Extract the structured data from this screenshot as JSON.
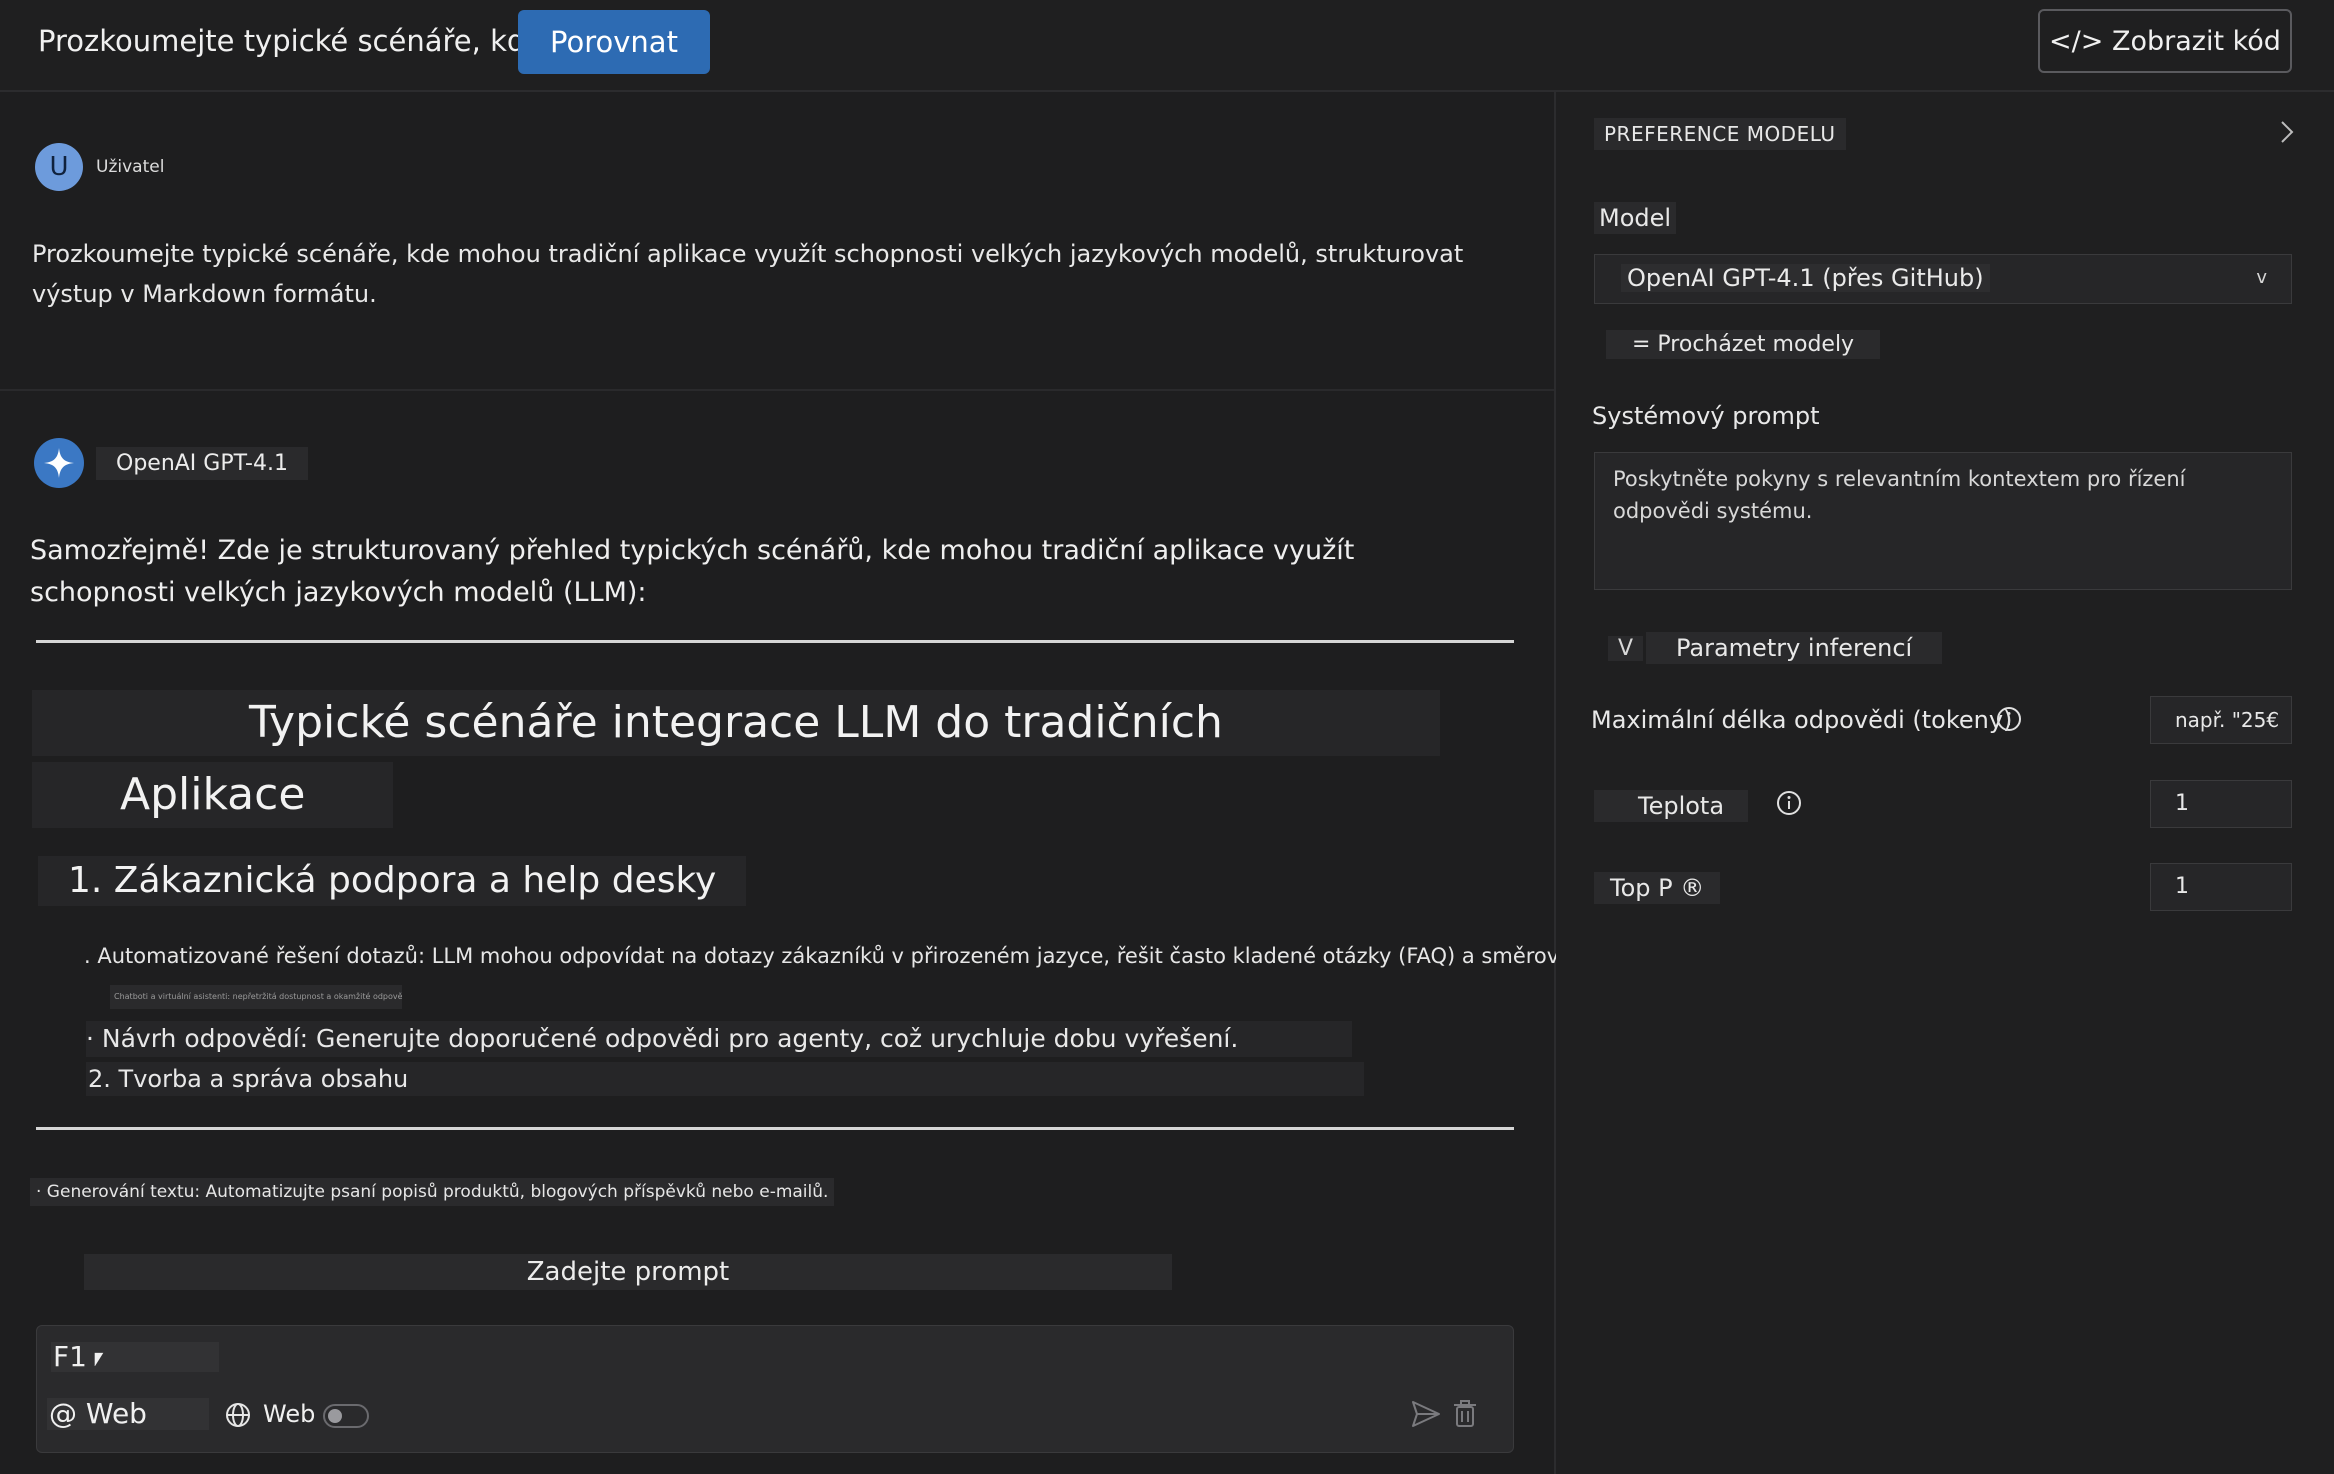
{
  "topbar": {
    "title": "Prozkoumejte typické scénáře, kde ...",
    "compare_label": "Porovnat",
    "show_code_label": "</> Zobrazit kód"
  },
  "chat": {
    "user": {
      "avatar_letter": "U",
      "name": "Uživatel",
      "message": "Prozkoumejte typické scénáře, kde mohou tradiční aplikace využít schopnosti velkých jazykových modelů, strukturovat výstup v Markdown formátu."
    },
    "assistant": {
      "name": "OpenAI GPT-4.1",
      "intro": "Samozřejmě! Zde je strukturovaný přehled typických scénářů, kde mohou tradiční aplikace využít schopnosti velkých jazykových modelů (LLM):",
      "heading_line1": "Typické scénáře integrace LLM do tradičních",
      "heading_line2": "Aplikace",
      "section1": "1. Zákaznická podpora a help desky",
      "item1": ". Automatizované řešení dotazů: LLM mohou odpovídat na dotazy zákazníků v přirozeném jazyce, řešit často kladené otázky (FAQ) a směrovat podporu.",
      "item1_sub": "Chatboti a virtuální asistenti: nepřetržitá dostupnost a okamžité odpovědi",
      "item2": "· Návrh odpovědí: Generujte doporučené odpovědi pro agenty, což urychluje dobu vyřešení.",
      "item3": "2. Tvorba a správa obsahu",
      "item4": "· Generování textu: Automatizujte psaní popisů produktů, blogových příspěvků nebo e-mailů."
    },
    "prompt_label": "Zadejte prompt",
    "input": {
      "value": "F1⎖",
      "web_mention": "@ Web",
      "web_toggle_label": "Web"
    }
  },
  "settings": {
    "header": "PREFERENCE MODELU",
    "model_label": "Model",
    "model_value": "OpenAI GPT-4.1 (přes GitHub)",
    "model_arrow": "v",
    "browse_label": "= Procházet modely",
    "system_prompt_label": "Systémový prompt",
    "system_prompt_placeholder": "Poskytněte pokyny s relevantním kontextem pro řízení odpovědi systému.",
    "inference_toggle": "V",
    "inference_label": "Parametry inferencí",
    "max_tokens_label": "Maximální délka odpovědi (tokeny)",
    "max_tokens_placeholder": "např. \"25€",
    "temperature_label": "Teplota",
    "temperature_value": "1",
    "top_p_label": "Top P ®",
    "top_p_value": "1"
  },
  "colors": {
    "accent": "#2d6bb3",
    "background": "#1e1e1f",
    "panel": "#1f1f20"
  }
}
